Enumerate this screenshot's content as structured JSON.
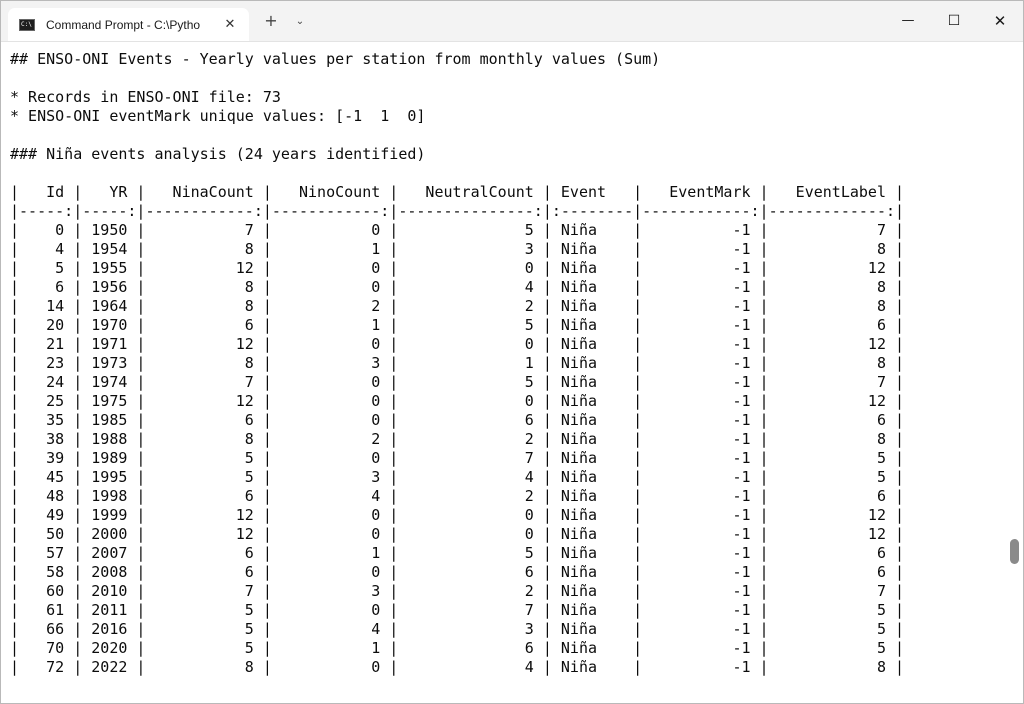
{
  "window": {
    "tab_title": "Command Prompt - C:\\Pytho",
    "tab_icon_text": "C:\\",
    "tab_close": "✕",
    "new_tab": "+",
    "tab_dropdown": "⌄",
    "minimize": "—",
    "maximize": "☐",
    "close": "✕"
  },
  "terminal": {
    "lines": [
      "## ENSO-ONI Events - Yearly values per station from monthly values (Sum)",
      "",
      "* Records in ENSO-ONI file: 73",
      "* ENSO-ONI eventMark unique values: [-1  1  0]",
      "",
      "### Niña events analysis (24 years identified)",
      "",
      "|   Id |   YR |   NinaCount |   NinoCount |   NeutralCount | Event   |   EventMark |   EventLabel |",
      "|-----:|-----:|------------:|------------:|---------------:|:--------|------------:|-------------:|",
      "|    0 | 1950 |           7 |           0 |              5 | Niña    |          -1 |            7 |",
      "|    4 | 1954 |           8 |           1 |              3 | Niña    |          -1 |            8 |",
      "|    5 | 1955 |          12 |           0 |              0 | Niña    |          -1 |           12 |",
      "|    6 | 1956 |           8 |           0 |              4 | Niña    |          -1 |            8 |",
      "|   14 | 1964 |           8 |           2 |              2 | Niña    |          -1 |            8 |",
      "|   20 | 1970 |           6 |           1 |              5 | Niña    |          -1 |            6 |",
      "|   21 | 1971 |          12 |           0 |              0 | Niña    |          -1 |           12 |",
      "|   23 | 1973 |           8 |           3 |              1 | Niña    |          -1 |            8 |",
      "|   24 | 1974 |           7 |           0 |              5 | Niña    |          -1 |            7 |",
      "|   25 | 1975 |          12 |           0 |              0 | Niña    |          -1 |           12 |",
      "|   35 | 1985 |           6 |           0 |              6 | Niña    |          -1 |            6 |",
      "|   38 | 1988 |           8 |           2 |              2 | Niña    |          -1 |            8 |",
      "|   39 | 1989 |           5 |           0 |              7 | Niña    |          -1 |            5 |",
      "|   45 | 1995 |           5 |           3 |              4 | Niña    |          -1 |            5 |",
      "|   48 | 1998 |           6 |           4 |              2 | Niña    |          -1 |            6 |",
      "|   49 | 1999 |          12 |           0 |              0 | Niña    |          -1 |           12 |",
      "|   50 | 2000 |          12 |           0 |              0 | Niña    |          -1 |           12 |",
      "|   57 | 2007 |           6 |           1 |              5 | Niña    |          -1 |            6 |",
      "|   58 | 2008 |           6 |           0 |              6 | Niña    |          -1 |            6 |",
      "|   60 | 2010 |           7 |           3 |              2 | Niña    |          -1 |            7 |",
      "|   61 | 2011 |           5 |           0 |              7 | Niña    |          -1 |            5 |",
      "|   66 | 2016 |           5 |           4 |              3 | Niña    |          -1 |            5 |",
      "|   70 | 2020 |           5 |           1 |              6 | Niña    |          -1 |            5 |",
      "|   72 | 2022 |           8 |           0 |              4 | Niña    |          -1 |            8 |"
    ]
  },
  "colors": {
    "terminal_background": "#ffffff",
    "terminal_text": "#0c0c0c",
    "titlebar": "#f3f3f3",
    "scroll_thumb": "#8a8a8a"
  }
}
